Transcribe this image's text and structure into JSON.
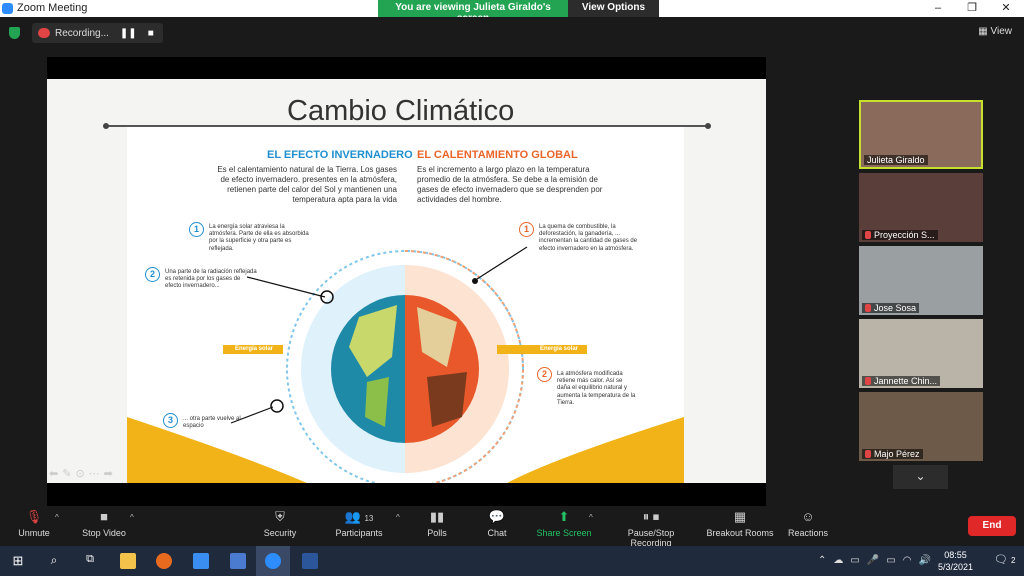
{
  "window": {
    "title": "Zoom Meeting"
  },
  "share_banner": {
    "viewing_text": "You are viewing Julieta Giraldo's screen",
    "view_options": "View Options"
  },
  "top": {
    "recording_label": "Recording...",
    "view_label": "View"
  },
  "slide": {
    "title": "Cambio Climático",
    "left": {
      "heading": "EL EFECTO INVERNADERO",
      "text": "Es el calentamiento natural de la Tierra. Los gases de efecto invernadero. presentes en la atmósfera, retienen parte del calor del Sol y mantienen una temperatura apta para la vida",
      "note1": "La energía solar atraviesa la atmósfera. Parte de ella es absorbida por la superficie y otra parte es reflejada.",
      "note2": "Una parte de la radiación reflejada es retenida por los gases de efecto invernadero...",
      "note3": "... otra parte vuelve al espacio",
      "solar": "Energía solar"
    },
    "right": {
      "heading": "EL CALENTAMIENTO GLOBAL",
      "text": "Es el incremento a largo plazo en la temperatura promedio de la atmósfera. Se debe a la emisión de gases de efecto invernadero que se desprenden por actividades del hombre.",
      "note1": "La quema de combustible, la deforestación, la ganadería, ... incrementan la cantidad de gases de efecto invernadero en la atmósfera.",
      "note2": "La atmósfera modificada retiene más calor. Así se daña el equilibrio natural y aumenta la temperatura de la Tierra.",
      "solar": "Energía solar"
    },
    "num1": "1",
    "num2": "2",
    "num3": "3"
  },
  "participants": [
    {
      "name": "Julieta Giraldo",
      "muted": false,
      "active": true
    },
    {
      "name": "Proyección S...",
      "muted": true,
      "active": false
    },
    {
      "name": "Jose Sosa",
      "muted": true,
      "active": false
    },
    {
      "name": "Jannette Chin...",
      "muted": true,
      "active": false
    },
    {
      "name": "Majo Pérez",
      "muted": true,
      "active": false
    }
  ],
  "controls": {
    "unmute": "Unmute",
    "stop_video": "Stop Video",
    "security": "Security",
    "participants": "Participants",
    "participant_count": "13",
    "polls": "Polls",
    "chat": "Chat",
    "share_screen": "Share Screen",
    "pause_recording": "Pause/Stop Recording",
    "breakout": "Breakout Rooms",
    "reactions": "Reactions",
    "end": "End"
  },
  "taskbar": {
    "time": "08:55",
    "date": "5/3/2021",
    "notifications": "2"
  },
  "colors": {
    "accent_green": "#23a453",
    "end_red": "#e02828",
    "blue_heading": "#1f8fcf",
    "orange_heading": "#e8652a"
  }
}
